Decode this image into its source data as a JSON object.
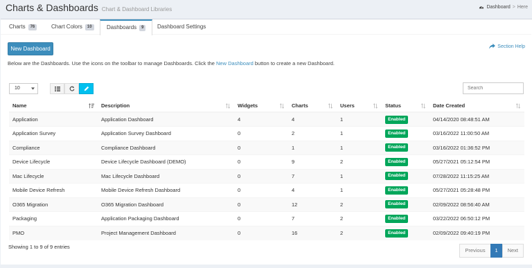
{
  "header": {
    "title": "Charts & Dashboards",
    "subtitle": "Chart & Dashboard Libraries",
    "breadcrumb": {
      "current": "Dashboard",
      "here": "Here"
    }
  },
  "tabs": [
    {
      "label": "Charts",
      "count": "76"
    },
    {
      "label": "Chart Colors",
      "count": "10"
    },
    {
      "label": "Dashboards",
      "count": "9"
    },
    {
      "label": "Dashboard Settings"
    }
  ],
  "toolbar": {
    "new_label": "New Dashboard",
    "help_label": "Section Help",
    "intro_before": "Below are the Dashboards. Use the icons on the toolbar to manage Dashboards. Click the ",
    "intro_link": "New Dashboard",
    "intro_after": " button to create a new Dashboard.",
    "page_size": "10",
    "search_placeholder": "Search"
  },
  "table": {
    "columns": [
      "Name",
      "Description",
      "Widgets",
      "Charts",
      "Users",
      "Status",
      "Date Created"
    ],
    "rows": [
      {
        "name": "Application",
        "description": "Application Dashboard",
        "widgets": "4",
        "charts": "4",
        "users": "1",
        "status": "Enabled",
        "date": "04/14/2020 08:48:51 AM"
      },
      {
        "name": "Application Survey",
        "description": "Application Survey Dashboard",
        "widgets": "0",
        "charts": "2",
        "users": "1",
        "status": "Enabled",
        "date": "03/16/2022 11:00:50 AM"
      },
      {
        "name": "Compliance",
        "description": "Compliance Dashboard",
        "widgets": "0",
        "charts": "1",
        "users": "1",
        "status": "Enabled",
        "date": "03/16/2022 01:36:52 PM"
      },
      {
        "name": "Device Lifecycle",
        "description": "Device Lifecycle Dashboard (DEMO)",
        "widgets": "0",
        "charts": "9",
        "users": "2",
        "status": "Enabled",
        "date": "05/27/2021 05:12:54 PM"
      },
      {
        "name": "Mac Lifecycle",
        "description": "Mac Lifecycle Dashboard",
        "widgets": "0",
        "charts": "7",
        "users": "1",
        "status": "Enabled",
        "date": "07/28/2022 11:15:25 AM"
      },
      {
        "name": "Mobile Device Refresh",
        "description": "Mobile Device Refresh Dashboard",
        "widgets": "0",
        "charts": "4",
        "users": "1",
        "status": "Enabled",
        "date": "05/27/2021 05:28:48 PM"
      },
      {
        "name": "O365 Migration",
        "description": "O365 Migration Dashboard",
        "widgets": "0",
        "charts": "12",
        "users": "2",
        "status": "Enabled",
        "date": "02/09/2022 08:56:40 AM"
      },
      {
        "name": "Packaging",
        "description": "Application Packaging Dashboard",
        "widgets": "0",
        "charts": "7",
        "users": "2",
        "status": "Enabled",
        "date": "03/22/2022 06:50:12 PM"
      },
      {
        "name": "PMO",
        "description": "Project Management Dashboard",
        "widgets": "0",
        "charts": "16",
        "users": "2",
        "status": "Enabled",
        "date": "02/09/2022 09:40:19 PM"
      }
    ]
  },
  "footer": {
    "info": "Showing 1 to 9 of 9 entries",
    "previous": "Previous",
    "current_page": "1",
    "next": "Next"
  },
  "colors": {
    "primary": "#3c8dbc",
    "status_enabled": "#00a65a",
    "tool_active": "#00c0ef",
    "page_active": "#337ab7"
  }
}
